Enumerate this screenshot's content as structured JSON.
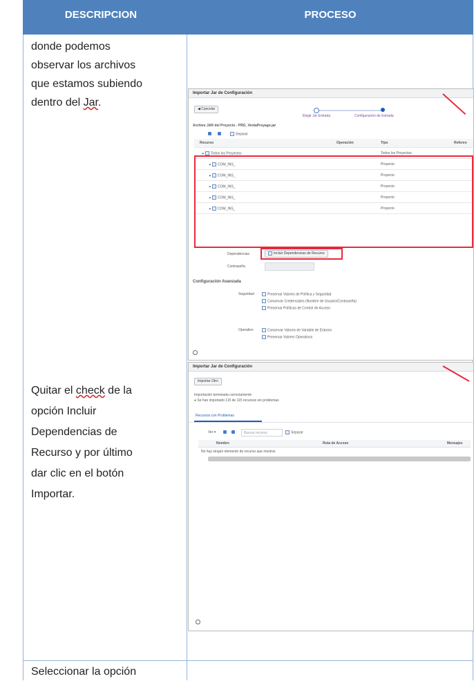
{
  "table": {
    "header_descripcion": "DESCRIPCION",
    "header_proceso": "PROCESO"
  },
  "row1": {
    "lines": [
      "donde podemos",
      "observar los archivos",
      "que estamos subiendo",
      "dentro del "
    ],
    "underlined": "Jar",
    "tail": "."
  },
  "row2": {
    "lines": [
      "Quitar el ",
      "opción Incluir",
      "Dependencias de",
      "Recurso y por último",
      "dar clic en el botón",
      "Importar."
    ],
    "underlined": "check",
    "after_underlined": " de la"
  },
  "row3": {
    "text": "Seleccionar la opción"
  },
  "screenshot1": {
    "window_title": "Importar Jar de Configuración",
    "back_button": "Cancelar",
    "step1": "Elegir Jar Entrada",
    "step2": "Configuración de Entrada",
    "archive_label": "Archivo JAR del Proyecto",
    "archive_value": "PRG_VentaProyago.jar",
    "refresh_label": "Separar",
    "columns": [
      "Recurso",
      "Operación",
      "Tipo",
      "Referen"
    ],
    "rows": [
      {
        "name": "Todos los Proyectos",
        "type": "Todos los Proyectos"
      },
      {
        "name": "COM_INS_",
        "type": "Proyecto"
      },
      {
        "name": "COM_INS_",
        "type": "Proyecto"
      },
      {
        "name": "COM_INS_",
        "type": "Proyecto"
      },
      {
        "name": "COM_INS_",
        "type": "Proyecto"
      },
      {
        "name": "COM_INS_",
        "type": "Proyecto"
      }
    ],
    "dependencies_label": "Dependencias",
    "dependencies_option": "Incluir Dependencias de Recurso",
    "password_label": "Contraseña",
    "advanced_title": "Configuración Avanzada",
    "security_label": "Seguridad",
    "security_options": [
      "Preservar Valores de Política y Seguridad",
      "Conservar Credenciales (Nombre de Usuario/Contraseña)",
      "Preservar Políticas de Control de Acceso"
    ],
    "operations_label": "Operativo",
    "operations_options": [
      "Conservar Valores de Variable de Entorno",
      "Preservar Valores Operativos"
    ]
  },
  "screenshot2": {
    "window_title": "Importar Jar de Configuración",
    "import_button": "Importar Otro",
    "status_line1": "Importación terminada correctamente",
    "status_line2": "Se han importado 115 de 115 recursos sin problemas",
    "tab_label": "Recursos con Problemas",
    "toolbar_view": "Ver",
    "search_placeholder": "Buscar recurso",
    "detach_label": "Separar",
    "columns": [
      "Nombre",
      "Ruta de Acceso",
      "Mensajes"
    ],
    "empty_message": "No hay ningún elemento de recurso que mostrar."
  },
  "colors": {
    "header_bg": "#4f81bd",
    "grid": "#95b3d7",
    "highlight": "#e8283a"
  }
}
